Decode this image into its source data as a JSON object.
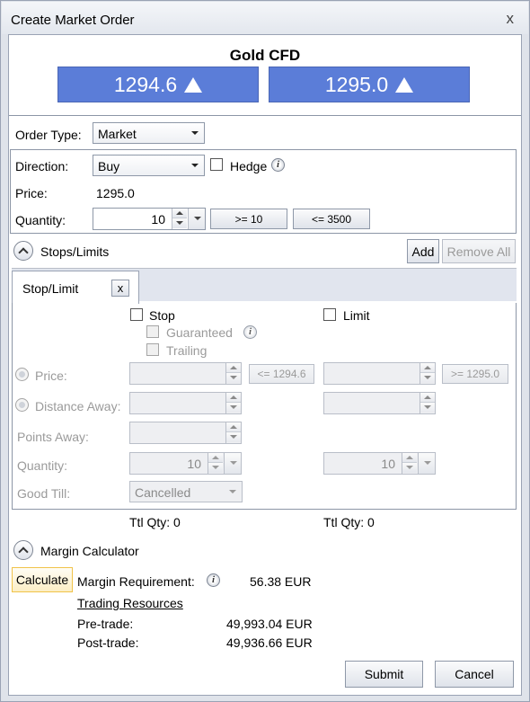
{
  "window": {
    "title": "Create Market Order",
    "close_glyph": "x"
  },
  "instrument": {
    "name": "Gold CFD",
    "sell_price": "1294.6",
    "buy_price": "1295.0"
  },
  "order_type": {
    "label": "Order Type:",
    "value": "Market"
  },
  "direction": {
    "label": "Direction:",
    "value": "Buy"
  },
  "hedge": {
    "label": "Hedge",
    "checked": false
  },
  "price": {
    "label": "Price:",
    "value": "1295.0"
  },
  "quantity": {
    "label": "Quantity:",
    "value": "10",
    "min_button": ">= 10",
    "max_button": "<= 3500"
  },
  "stops_limits": {
    "header": "Stops/Limits",
    "add_label": "Add",
    "remove_all_label": "Remove All",
    "tab_label": "Stop/Limit",
    "tab_close": "x",
    "stop_label": "Stop",
    "limit_label": "Limit",
    "guaranteed_label": "Guaranteed",
    "trailing_label": "Trailing",
    "price_label": "Price:",
    "distance_label": "Distance Away:",
    "points_label": "Points Away:",
    "quantity_label": "Quantity:",
    "good_till_label": "Good Till:",
    "stop_price_hint": "<= 1294.6",
    "limit_price_hint": ">= 1295.0",
    "stop_quantity": "10",
    "limit_quantity": "10",
    "good_till_value": "Cancelled",
    "stop_ttl_qty": "Ttl Qty: 0",
    "limit_ttl_qty": "Ttl Qty: 0"
  },
  "margin": {
    "header": "Margin Calculator",
    "calculate_label": "Calculate",
    "requirement_label": "Margin Requirement:",
    "requirement_value": "56.38 EUR",
    "trading_resources_label": "Trading Resources",
    "pre_trade_label": "Pre-trade:",
    "pre_trade_value": "49,993.04 EUR",
    "post_trade_label": "Post-trade:",
    "post_trade_value": "49,936.66 EUR"
  },
  "footer": {
    "submit_label": "Submit",
    "cancel_label": "Cancel"
  },
  "colors": {
    "price_button": "#5b7dd8",
    "window_frame": "#dfe3ea",
    "calculate_highlight": "#f0c34a"
  }
}
